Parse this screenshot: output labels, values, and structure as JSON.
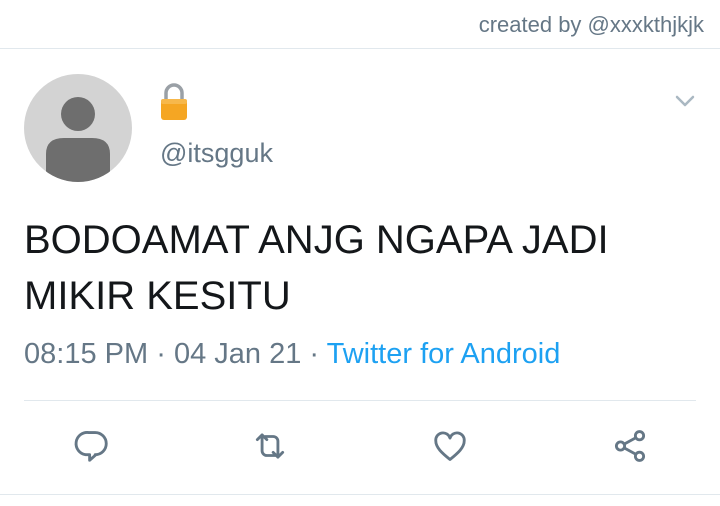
{
  "credit": "created by @xxxkthjkjk",
  "author": {
    "handle": "@itsgguk",
    "avatar_icon": "default-avatar-icon",
    "protected_icon": "lock-icon"
  },
  "tweet": {
    "text_line1": "BODOAMAT ANJG NGAPA JADI",
    "text_line2": "MIKIR KESITU",
    "time": "08:15 PM",
    "separator": "·",
    "date": "04 Jan 21",
    "source": "Twitter for Android"
  },
  "actions": [
    {
      "name": "reply",
      "icon": "reply-icon"
    },
    {
      "name": "retweet",
      "icon": "retweet-icon"
    },
    {
      "name": "like",
      "icon": "heart-icon"
    },
    {
      "name": "share",
      "icon": "share-icon"
    }
  ],
  "colors": {
    "accent": "#1da1f2",
    "secondary_text": "#657786",
    "primary_text": "#14171a",
    "divider": "#e1e8ed",
    "lock": "#f5a623"
  }
}
